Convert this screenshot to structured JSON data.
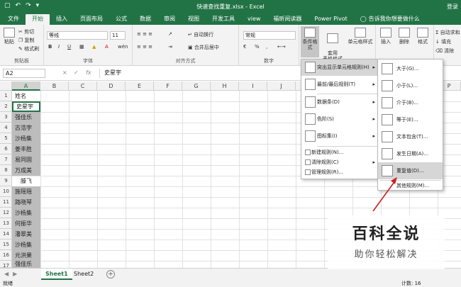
{
  "window": {
    "title": "快速查找重复.xlsx - Excel",
    "user": "登录",
    "quick_access": [
      "save-icon",
      "undo-icon",
      "redo-icon"
    ]
  },
  "menu": {
    "items": [
      "文件",
      "开始",
      "插入",
      "页面布局",
      "公式",
      "数据",
      "审阅",
      "视图",
      "开发工具",
      "view",
      "福昕阅读器",
      "Power Pivot"
    ],
    "active": "开始",
    "tell_me": "告诉我你想要做什么"
  },
  "ribbon": {
    "clipboard": {
      "paste": "粘贴",
      "cut": "剪切",
      "copy": "复制",
      "format_painter": "格式刷",
      "label": "剪贴板"
    },
    "font": {
      "name": "等线",
      "size": "11",
      "bold": "B",
      "italic": "I",
      "underline": "U",
      "grow": "A",
      "shrink": "A",
      "wen": "wén",
      "label": "字体"
    },
    "alignment": {
      "wrap": "自动换行",
      "merge": "合并后居中",
      "label": "对齐方式"
    },
    "number": {
      "format": "常规",
      "percent": "%",
      "comma": ",",
      "label": "数字"
    },
    "styles": {
      "conditional": "条件格式",
      "table": "套用\n表格格式",
      "cell_styles": "单元格样式"
    },
    "cells": {
      "insert": "插入",
      "delete": "删除",
      "format": "格式"
    },
    "editing": {
      "autosum": "自动求和",
      "fill": "填充",
      "clear": "清除"
    }
  },
  "formula_bar": {
    "name_box": "A2",
    "fx": "fx",
    "cancel": "×",
    "confirm": "✓",
    "content": "史星宇"
  },
  "columns": [
    "A",
    "B",
    "C",
    "D",
    "E",
    "F",
    "G",
    "H",
    "I",
    "J",
    "K",
    "L",
    "M",
    "N",
    "O",
    "P"
  ],
  "rows": [
    "1",
    "2",
    "3",
    "4",
    "5",
    "6",
    "7",
    "8",
    "9",
    "10",
    "11",
    "12",
    "13",
    "14",
    "15",
    "16",
    "17"
  ],
  "cells_a": [
    {
      "text": "姓名",
      "dup": false
    },
    {
      "text": "史星宇",
      "dup": false
    },
    {
      "text": "强佳乐",
      "dup": true
    },
    {
      "text": "古浩宇",
      "dup": true
    },
    {
      "text": "沙杨集",
      "dup": true
    },
    {
      "text": "姜丰胜",
      "dup": true
    },
    {
      "text": "易同固",
      "dup": true
    },
    {
      "text": "万成美",
      "dup": true
    },
    {
      "text": "滕飞",
      "dup": false
    },
    {
      "text": "施瑶瑶",
      "dup": true
    },
    {
      "text": "路晓琴",
      "dup": true
    },
    {
      "text": "沙杨集",
      "dup": true
    },
    {
      "text": "何振华",
      "dup": true
    },
    {
      "text": "潘翠美",
      "dup": true
    },
    {
      "text": "沙杨集",
      "dup": true
    },
    {
      "text": "元洪果",
      "dup": true
    },
    {
      "text": "强佳乐",
      "dup": true
    }
  ],
  "cf_menu": {
    "items": [
      {
        "label": "突出显示单元格规则(H)",
        "arrow": "▸"
      },
      {
        "label": "最前/最后规则(T)",
        "arrow": "▸"
      },
      {
        "label": "数据条(D)",
        "arrow": "▸"
      },
      {
        "label": "色阶(S)",
        "arrow": "▸"
      },
      {
        "label": "图标集(I)",
        "arrow": "▸"
      }
    ],
    "small_items": [
      {
        "label": "新建规则(N)...",
        "arrow": ""
      },
      {
        "label": "清除规则(C)",
        "arrow": "▸"
      },
      {
        "label": "管理规则(R)...",
        "arrow": ""
      }
    ]
  },
  "sub_menu": {
    "items": [
      "大于(G)...",
      "小于(L)...",
      "介于(B)...",
      "等于(E)...",
      "文本包含(T)...",
      "发生日期(A)...",
      "重复值(D)..."
    ],
    "more": "其他规则(M)..."
  },
  "sheets": {
    "tabs": [
      "Sheet1",
      "Sheet2"
    ],
    "active": "Sheet1",
    "add": "+"
  },
  "status": {
    "left": "就绪",
    "count": "计数: 16"
  },
  "watermark": {
    "line1": "百科全说",
    "line2": "助你轻松解决"
  },
  "colors": {
    "accent": "#217346",
    "dup_fill": "#bcbcbc",
    "arrow": "#cc2222"
  }
}
